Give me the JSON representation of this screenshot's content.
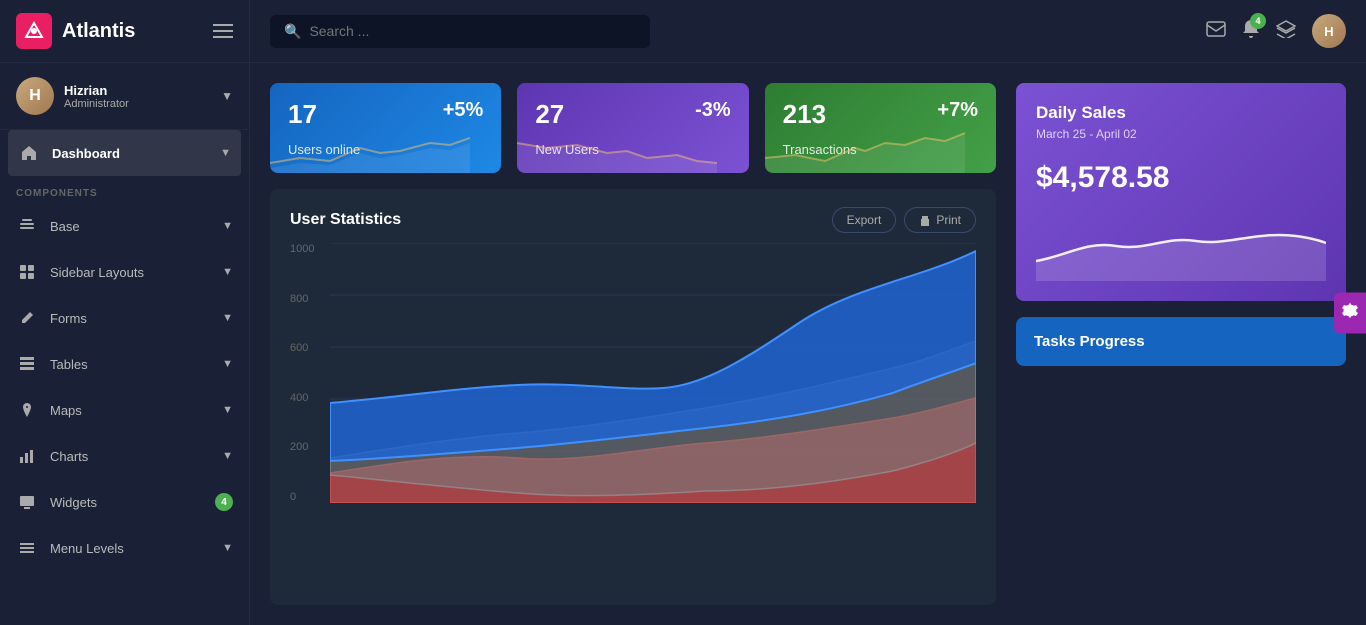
{
  "brand": {
    "name": "Atlantis",
    "icon_letter": "A"
  },
  "user": {
    "name": "Hizrian",
    "role": "Administrator"
  },
  "sidebar": {
    "active_item": "Dashboard",
    "nav_items": [
      {
        "label": "Dashboard",
        "icon": "home",
        "active": true,
        "arrow": true
      },
      {
        "label": "Base",
        "icon": "layers",
        "active": false,
        "arrow": true
      },
      {
        "label": "Sidebar Layouts",
        "icon": "grid",
        "active": false,
        "arrow": true
      },
      {
        "label": "Forms",
        "icon": "edit",
        "active": false,
        "arrow": true
      },
      {
        "label": "Tables",
        "icon": "table",
        "active": false,
        "arrow": true
      },
      {
        "label": "Maps",
        "icon": "map-pin",
        "active": false,
        "arrow": true
      },
      {
        "label": "Charts",
        "icon": "bar-chart",
        "active": false,
        "arrow": true
      },
      {
        "label": "Widgets",
        "icon": "monitor",
        "active": false,
        "arrow": true,
        "badge": "4"
      },
      {
        "label": "Menu Levels",
        "icon": "menu",
        "active": false,
        "arrow": true
      }
    ],
    "section_label": "COMPONENTS"
  },
  "header": {
    "search_placeholder": "Search ...",
    "notifications_count": "4"
  },
  "stats": [
    {
      "number": "17",
      "label": "Users online",
      "change": "+5%",
      "color": "blue"
    },
    {
      "number": "27",
      "label": "New Users",
      "change": "-3%",
      "color": "purple"
    },
    {
      "number": "213",
      "label": "Transactions",
      "change": "+7%",
      "color": "green"
    }
  ],
  "user_statistics": {
    "title": "User Statistics",
    "export_label": "Export",
    "print_label": "Print",
    "y_labels": [
      "1000",
      "800",
      "600",
      "400",
      "200",
      "0"
    ]
  },
  "daily_sales": {
    "title": "Daily Sales",
    "date_range": "March 25 - April 02",
    "amount": "$4,578.58"
  },
  "tasks": {
    "title": "Tasks Progress"
  }
}
